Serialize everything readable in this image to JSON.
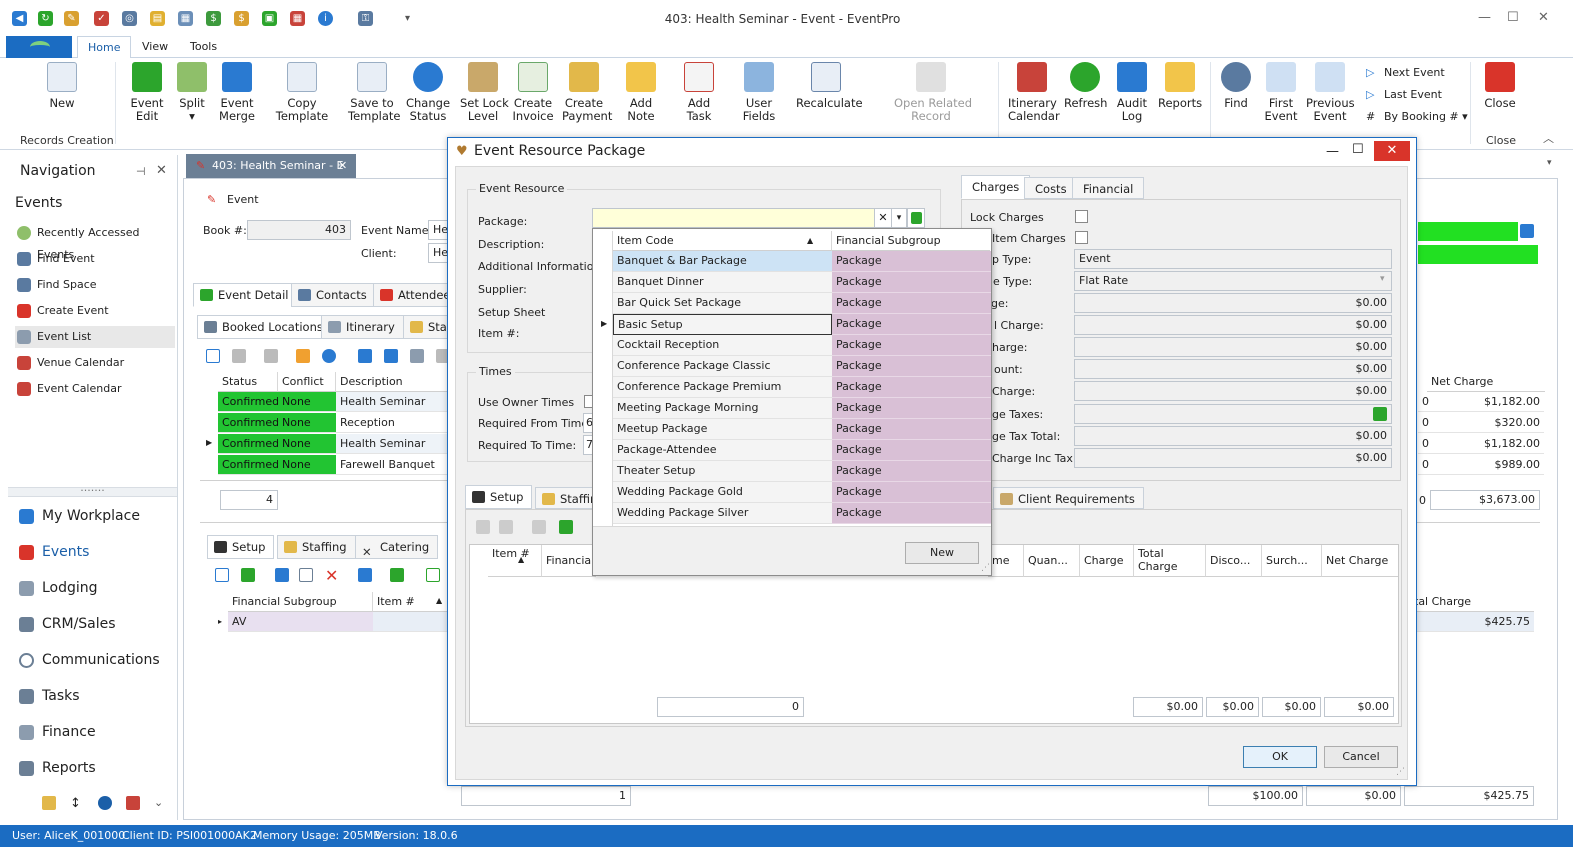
{
  "window": {
    "title": "403: Health Seminar - Event - EventPro"
  },
  "ribbon": {
    "tabs": [
      "Home",
      "View",
      "Tools"
    ],
    "buttons": {
      "new": "New",
      "event_edit": "Event\nEdit",
      "split": "Split",
      "event_merge": "Event\nMerge",
      "copy_template": "Copy Template",
      "save_template": "Save to\nTemplate",
      "change_status": "Change\nStatus",
      "set_lock_level": "Set Lock\nLevel",
      "create_invoice": "Create\nInvoice",
      "create_payment": "Create\nPayment",
      "add_note": "Add Note",
      "add_task": "Add Task",
      "user_fields": "User Fields",
      "recalculate": "Recalculate",
      "open_related": "Open Related\nRecord",
      "itinerary_calendar": "Itinerary\nCalendar",
      "refresh": "Refresh",
      "audit_log": "Audit\nLog",
      "reports": "Reports",
      "find": "Find",
      "first_event": "First\nEvent",
      "previous_event": "Previous\nEvent",
      "next_event": "Next Event",
      "last_event": "Last Event",
      "by_booking": "By Booking #",
      "close": "Close"
    },
    "groups": {
      "records_creation": "Records Creation",
      "close": "Close"
    }
  },
  "navigation": {
    "title": "Navigation",
    "section": "Events",
    "items": [
      "Recently Accessed Events",
      "Find Event",
      "Find Space",
      "Create Event",
      "Event List",
      "Venue Calendar",
      "Event Calendar"
    ],
    "modules": [
      "My Workplace",
      "Events",
      "Lodging",
      "CRM/Sales",
      "Communications",
      "Tasks",
      "Finance",
      "Reports"
    ]
  },
  "doc_tab": {
    "label": "403: Health Seminar - E"
  },
  "event": {
    "section": "Event",
    "book_label": "Book #:",
    "book_value": "403",
    "name_label": "Event Name:",
    "name_value": "Hea",
    "client_label": "Client:",
    "client_value": "Hea"
  },
  "detail_tabs": [
    "Event Detail",
    "Contacts",
    "Attendee"
  ],
  "location_tabs": [
    "Booked Locations",
    "Itinerary",
    "Sta"
  ],
  "locations_grid": {
    "headers": [
      "Status",
      "Conflict",
      "Description"
    ],
    "rows": [
      {
        "status": "Confirmed",
        "conflict": "None",
        "description": "Health Seminar"
      },
      {
        "status": "Confirmed",
        "conflict": "None",
        "description": "Reception"
      },
      {
        "status": "Confirmed",
        "conflict": "None",
        "description": "Health Seminar"
      },
      {
        "status": "Confirmed",
        "conflict": "None",
        "description": "Farewell Banquet"
      }
    ],
    "count": "4"
  },
  "right_grid": {
    "header": "Net Charge",
    "rows": [
      "$1,182.00",
      "$320.00",
      "$1,182.00",
      "$989.00"
    ],
    "partial": [
      "0",
      "0",
      "0",
      "0"
    ],
    "total": "$3,673.00",
    "total_prefix": "0"
  },
  "lower_tabs": [
    "Setup",
    "Staffing",
    "Catering"
  ],
  "lower_grid": {
    "headers": [
      "Financial Subgroup",
      "Item #"
    ],
    "row": "AV",
    "total_charge_header": "tal Charge",
    "total_charge_value": "$425.75"
  },
  "footer_row": {
    "count": "1",
    "charge": "$100.00",
    "disc": "$0.00",
    "net": "$425.75"
  },
  "dialog": {
    "title": "Event Resource Package",
    "event_resource": "Event Resource",
    "package_label": "Package:",
    "description_label": "Description:",
    "additional_info_label": "Additional Information:",
    "supplier_label": "Supplier:",
    "setup_sheet_label": "Setup Sheet",
    "item_label": "Item #:",
    "times": "Times",
    "use_owner_times": "Use Owner Times",
    "required_from": "Required From Time:",
    "required_from_value": "6",
    "required_to": "Required To Time:",
    "required_to_value": "7",
    "charge_tabs": [
      "Charges",
      "Costs",
      "Financial"
    ],
    "lock_charges": "Lock Charges",
    "item_charges": "Item Charges",
    "charge_fields": [
      {
        "label": "p Type:",
        "value": "Event",
        "style": "plain"
      },
      {
        "label": "ge Type:",
        "value": "Flat Rate",
        "style": "combo"
      },
      {
        "label": "ge:",
        "value": "$0.00",
        "style": "right"
      },
      {
        "label": "l Charge:",
        "value": "$0.00",
        "style": "right"
      },
      {
        "label": "harge:",
        "value": "$0.00",
        "style": "right"
      },
      {
        "label": "ount:",
        "value": "$0.00",
        "style": "right"
      },
      {
        "label": "Charge:",
        "value": "$0.00",
        "style": "right"
      },
      {
        "label": "ge Taxes:",
        "value": "",
        "style": "icon"
      },
      {
        "label": "ge Tax Total:",
        "value": "$0.00",
        "style": "right"
      },
      {
        "label": "Charge Inc Tax:",
        "value": "$0.00",
        "style": "right"
      }
    ],
    "bottom_tabs": [
      "Setup",
      "Staffin",
      "Client Requirements"
    ],
    "grid_headers": [
      "Item #",
      "Financial S",
      "me",
      "Quan...",
      "Charge",
      "Total Charge",
      "Disco...",
      "Surch...",
      "Net Charge"
    ],
    "grid_footer": {
      "count": "0",
      "total": "$0.00",
      "disc": "$0.00",
      "surch": "$0.00",
      "net": "$0.00"
    },
    "ok": "OK",
    "cancel": "Cancel"
  },
  "package_dropdown": {
    "headers": [
      "Item Code",
      "Financial Subgroup"
    ],
    "rows": [
      {
        "code": "Banquet & Bar Package",
        "group": "Package"
      },
      {
        "code": "Banquet Dinner",
        "group": "Package"
      },
      {
        "code": "Bar Quick Set Package",
        "group": "Package"
      },
      {
        "code": "Basic Setup",
        "group": "Package"
      },
      {
        "code": "Cocktail Reception",
        "group": "Package"
      },
      {
        "code": "Conference Package Classic",
        "group": "Package"
      },
      {
        "code": "Conference Package Premium",
        "group": "Package"
      },
      {
        "code": "Meeting Package Morning",
        "group": "Package"
      },
      {
        "code": "Meetup Package",
        "group": "Package"
      },
      {
        "code": "Package-Attendee",
        "group": "Package"
      },
      {
        "code": "Theater Setup",
        "group": "Package"
      },
      {
        "code": "Wedding Package Gold",
        "group": "Package"
      },
      {
        "code": "Wedding Package Silver",
        "group": "Package"
      }
    ],
    "new_button": "New"
  },
  "status": {
    "user": "User: AliceK_001000",
    "client_id": "Client ID: PSI001000AK2",
    "memory": "Memory Usage: 205MB",
    "version": "Version: 18.0.6"
  },
  "colors": {
    "accent": "#1b6cc2",
    "confirmed_green": "#22c432",
    "package_purple": "#d9c0d6",
    "selection_blue": "#cde3f5",
    "yellow_field": "#ffffd9"
  }
}
